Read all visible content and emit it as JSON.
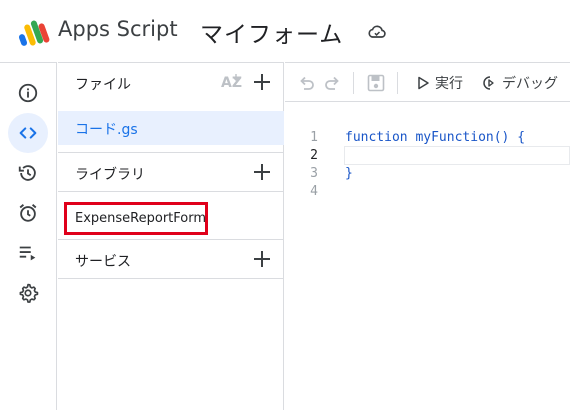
{
  "header": {
    "app_name": "Apps Script",
    "project_name": "マイフォーム"
  },
  "rail": {
    "items": [
      {
        "name": "overview",
        "icon": "info-icon"
      },
      {
        "name": "editor",
        "icon": "code-icon",
        "active": true
      },
      {
        "name": "executions",
        "icon": "history-icon"
      },
      {
        "name": "triggers",
        "icon": "alarm-icon"
      },
      {
        "name": "executions-log",
        "icon": "playlist-play-icon"
      },
      {
        "name": "settings",
        "icon": "gear-icon"
      }
    ]
  },
  "panel": {
    "files_label": "ファイル",
    "file_item": "コード.gs",
    "libraries_label": "ライブラリ",
    "library_item": "ExpenseReportForm",
    "services_label": "サービス"
  },
  "toolbar": {
    "run_label": "実行",
    "debug_label": "デバッグ"
  },
  "editor": {
    "lines": [
      {
        "num": "1",
        "keyword": "function",
        "rest": " myFunction() {"
      },
      {
        "num": "2",
        "keyword": "",
        "rest": ""
      },
      {
        "num": "3",
        "keyword": "",
        "rest": "}"
      },
      {
        "num": "4",
        "keyword": "",
        "rest": ""
      }
    ]
  },
  "colors": {
    "accent": "#1a73e8",
    "active_bg": "#e8f0fe",
    "highlight_box": "#e0001b",
    "keyword": "#1a56c8"
  }
}
